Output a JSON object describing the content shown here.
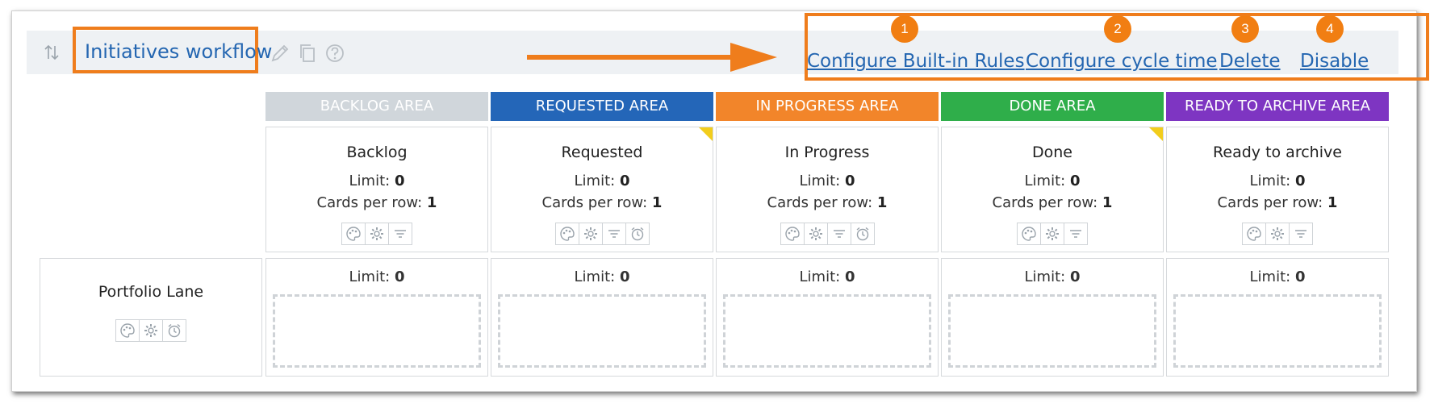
{
  "workflow": {
    "title": "Initiatives workflow"
  },
  "actions": [
    {
      "badge": "1",
      "label": "Configure Built-in Rules"
    },
    {
      "badge": "2",
      "label": "Configure cycle time"
    },
    {
      "badge": "3",
      "label": "Delete"
    },
    {
      "badge": "4",
      "label": "Disable"
    }
  ],
  "areas": [
    {
      "label": "BACKLOG AREA",
      "color": "#d0d6db"
    },
    {
      "label": "REQUESTED AREA",
      "color": "#2466b8"
    },
    {
      "label": "IN PROGRESS AREA",
      "color": "#f2852a"
    },
    {
      "label": "DONE AREA",
      "color": "#2fae4a"
    },
    {
      "label": "READY TO ARCHIVE AREA",
      "color": "#7e35c2"
    }
  ],
  "columns": [
    {
      "name": "Backlog",
      "limit_label": "Limit:",
      "limit": "0",
      "cpr_label": "Cards per row:",
      "cpr": "1"
    },
    {
      "name": "Requested",
      "limit_label": "Limit:",
      "limit": "0",
      "cpr_label": "Cards per row:",
      "cpr": "1"
    },
    {
      "name": "In Progress",
      "limit_label": "Limit:",
      "limit": "0",
      "cpr_label": "Cards per row:",
      "cpr": "1"
    },
    {
      "name": "Done",
      "limit_label": "Limit:",
      "limit": "0",
      "cpr_label": "Cards per row:",
      "cpr": "1"
    },
    {
      "name": "Ready to archive",
      "limit_label": "Limit:",
      "limit": "0",
      "cpr_label": "Cards per row:",
      "cpr": "1"
    }
  ],
  "lane": {
    "name": "Portfolio Lane",
    "cells": [
      {
        "limit_label": "Limit:",
        "limit": "0"
      },
      {
        "limit_label": "Limit:",
        "limit": "0"
      },
      {
        "limit_label": "Limit:",
        "limit": "0"
      },
      {
        "limit_label": "Limit:",
        "limit": "0"
      },
      {
        "limit_label": "Limit:",
        "limit": "0"
      }
    ]
  },
  "colors": {
    "accent_orange": "#ef7d1c",
    "link_blue": "#2466b1",
    "rule_corner": "#f2cd1c"
  }
}
